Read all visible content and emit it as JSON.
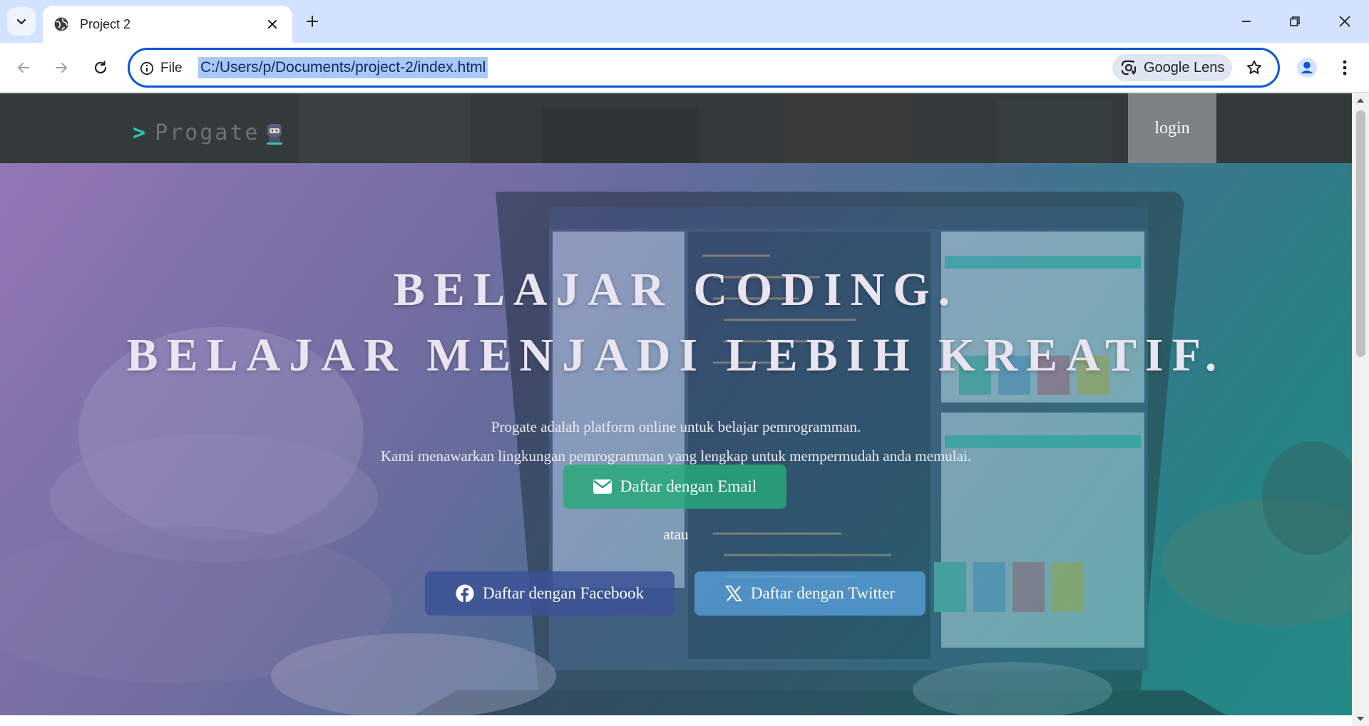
{
  "browser": {
    "tab_title": "Project 2",
    "site_info_label": "File",
    "url": "C:/Users/p/Documents/project-2/index.html",
    "lens_label": "Google Lens",
    "icons": [
      "chevron-down-icon",
      "globe-icon",
      "close-icon",
      "plus-icon",
      "minimize-icon",
      "restore-icon",
      "close-window-icon",
      "back-arrow-icon",
      "forward-arrow-icon",
      "reload-icon",
      "info-icon",
      "lens-icon",
      "star-icon",
      "profile-icon",
      "more-vert-icon"
    ]
  },
  "header": {
    "logo_text": "Progate",
    "logo_arrow": ">",
    "login_label": "login"
  },
  "hero": {
    "title_line1": "BELAJAR CODING.",
    "title_line2": "BELAJAR MENJADI LEBIH KREATIF.",
    "desc_line1": "Progate adalah platform online untuk belajar pemrogramman.",
    "desc_line2": "Kami menawarkan lingkungan pemrogramman yang lengkap untuk mempermudah anda memulai.",
    "email_button": "Daftar dengan Email",
    "separator": "atau",
    "facebook_button": "Daftar dengan Facebook",
    "twitter_button": "Daftar dengan Twitter"
  },
  "colors": {
    "accent_blue": "#0b57d0",
    "email_green": "#26aa78",
    "facebook_blue": "#3c5296",
    "twitter_blue": "#58a2dc",
    "logo_teal": "#2fc6b3"
  }
}
